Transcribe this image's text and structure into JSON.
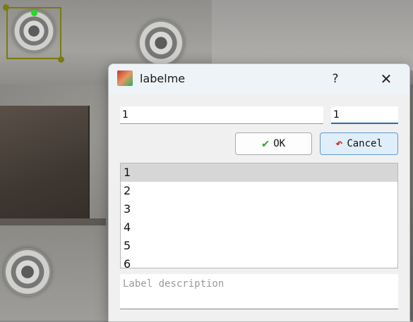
{
  "dialog": {
    "title": "labelme",
    "help_label": "?",
    "close_label": "✕",
    "label_value": "1",
    "group_id_value": "1",
    "ok_label": "OK",
    "cancel_label": "Cancel",
    "label_list": [
      "1",
      "2",
      "3",
      "4",
      "5",
      "6"
    ],
    "selected_index": 0,
    "description_placeholder": "Label description"
  },
  "icons": {
    "app": "labelme-app-icon",
    "ok": "checkmark-icon",
    "cancel": "undo-arrow-icon"
  },
  "colors": {
    "bbox": "#7a7a10",
    "active_handle": "#22dd22",
    "focus_accent": "#1f6fb2"
  }
}
